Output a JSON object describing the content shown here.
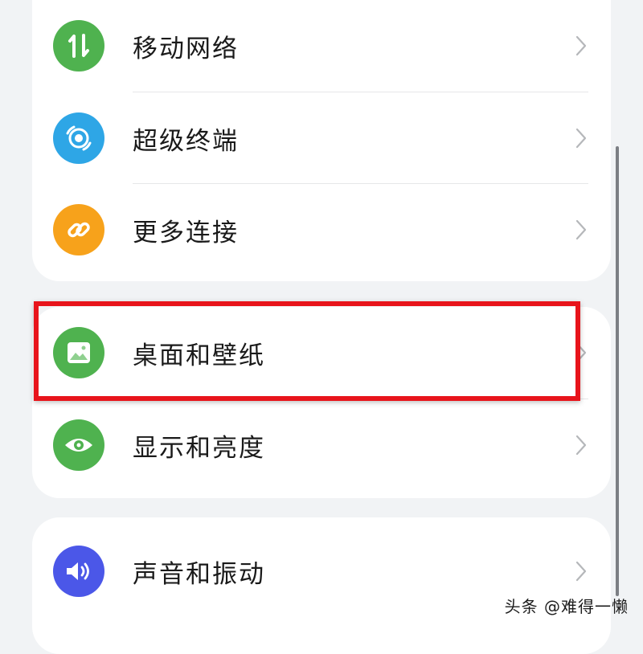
{
  "settings": {
    "items": [
      {
        "label": "移动网络",
        "icon": "mobile-network-icon",
        "color": "#4fb24f"
      },
      {
        "label": "超级终端",
        "icon": "super-device-icon",
        "color": "#2ea6e6"
      },
      {
        "label": "更多连接",
        "icon": "link-icon",
        "color": "#f7a21b"
      },
      {
        "label": "桌面和壁纸",
        "icon": "wallpaper-icon",
        "color": "#4fb24f"
      },
      {
        "label": "显示和亮度",
        "icon": "eye-icon",
        "color": "#4fb24f"
      },
      {
        "label": "声音和振动",
        "icon": "speaker-icon",
        "color": "#4b57e8"
      }
    ]
  },
  "annotation": {
    "highlight_color": "#e8141b"
  },
  "watermark": {
    "text": "头条 @难得一懒"
  }
}
